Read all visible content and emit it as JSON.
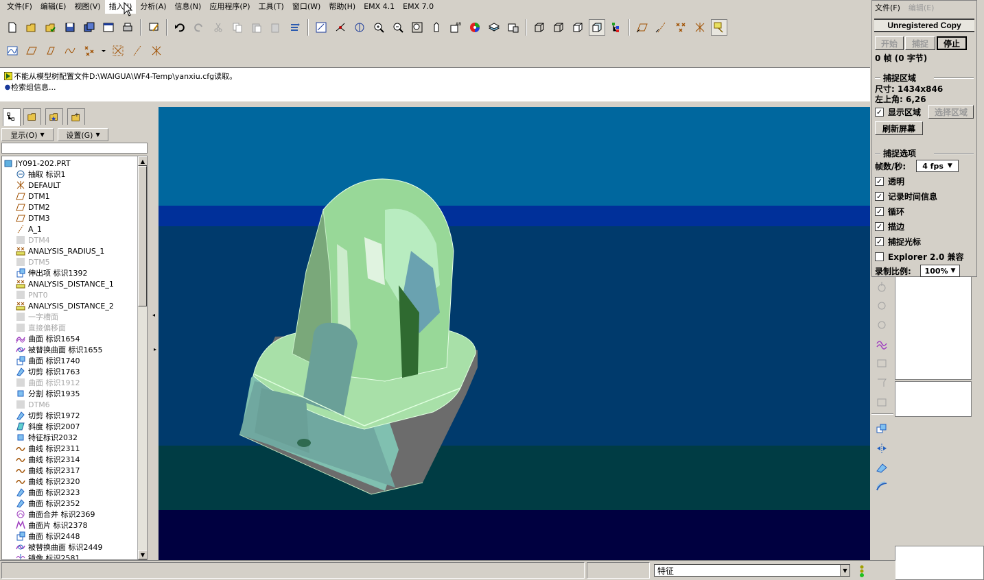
{
  "menu": [
    "文件(F)",
    "编辑(E)",
    "视图(V)",
    "插入(I)",
    "分析(A)",
    "信息(N)",
    "应用程序(P)",
    "工具(T)",
    "窗口(W)",
    "帮助(H)",
    "EMX 4.1",
    "EMX 7.0"
  ],
  "messages": [
    "不能从模型树配置文件D:\\WAIGUA\\WF4-Temp\\yanxiu.cfg读取。",
    "检索组信息..."
  ],
  "panel": {
    "show_label": "显示(O)",
    "settings_label": "设置(G)"
  },
  "tree": [
    {
      "label": "JY091-202.PRT",
      "icon": "part-icon",
      "dim": false
    },
    {
      "label": "抽取 标识1",
      "icon": "extract-icon",
      "dim": false
    },
    {
      "label": "DEFAULT",
      "icon": "csys-icon",
      "dim": false
    },
    {
      "label": "DTM1",
      "icon": "datum-plane-icon",
      "dim": false
    },
    {
      "label": "DTM2",
      "icon": "datum-plane-icon",
      "dim": false
    },
    {
      "label": "DTM3",
      "icon": "datum-plane-icon",
      "dim": false
    },
    {
      "label": "A_1",
      "icon": "datum-axis-icon",
      "dim": false
    },
    {
      "label": "DTM4",
      "icon": "suppressed-icon",
      "dim": true
    },
    {
      "label": "ANALYSIS_RADIUS_1",
      "icon": "analysis-icon",
      "dim": false
    },
    {
      "label": "DTM5",
      "icon": "suppressed-icon",
      "dim": true
    },
    {
      "label": "伸出项 标识1392",
      "icon": "protrusion-icon",
      "dim": false
    },
    {
      "label": "ANALYSIS_DISTANCE_1",
      "icon": "analysis-icon",
      "dim": false
    },
    {
      "label": "PNT0",
      "icon": "suppressed-icon",
      "dim": true
    },
    {
      "label": "ANALYSIS_DISTANCE_2",
      "icon": "analysis-icon",
      "dim": false
    },
    {
      "label": "一字槽面",
      "icon": "suppressed-icon",
      "dim": true
    },
    {
      "label": "直接偏移面",
      "icon": "suppressed-icon",
      "dim": true
    },
    {
      "label": "曲面 标识1654",
      "icon": "surface-icon",
      "dim": false
    },
    {
      "label": "被替换曲面 标识1655",
      "icon": "replace-surface-icon",
      "dim": false
    },
    {
      "label": "曲面 标识1740",
      "icon": "protrusion-icon",
      "dim": false
    },
    {
      "label": "切剪 标识1763",
      "icon": "cut-icon",
      "dim": false
    },
    {
      "label": "曲面 标识1912",
      "icon": "suppressed-icon",
      "dim": true
    },
    {
      "label": "分割 标识1935",
      "icon": "split-icon",
      "dim": false
    },
    {
      "label": "DTM6",
      "icon": "suppressed-icon",
      "dim": true
    },
    {
      "label": "切剪 标识1972",
      "icon": "cut-icon",
      "dim": false
    },
    {
      "label": "斜度 标识2007",
      "icon": "draft-icon",
      "dim": false
    },
    {
      "label": "特征标识2032",
      "icon": "split-icon",
      "dim": false
    },
    {
      "label": "曲线 标识2311",
      "icon": "curve-icon",
      "dim": false
    },
    {
      "label": "曲线 标识2314",
      "icon": "curve-icon",
      "dim": false
    },
    {
      "label": "曲线 标识2317",
      "icon": "curve-icon",
      "dim": false
    },
    {
      "label": "曲线 标识2320",
      "icon": "curve-icon",
      "dim": false
    },
    {
      "label": "曲面 标识2323",
      "icon": "cut-icon",
      "dim": false
    },
    {
      "label": "曲面 标识2352",
      "icon": "cut-icon",
      "dim": false
    },
    {
      "label": "曲面合并 标识2369",
      "icon": "merge-icon",
      "dim": false
    },
    {
      "label": "曲面片 标识2378",
      "icon": "patch-icon",
      "dim": false
    },
    {
      "label": "曲面 标识2448",
      "icon": "protrusion-icon",
      "dim": false
    },
    {
      "label": "被替换曲面 标识2449",
      "icon": "replace-surface-icon",
      "dim": false
    },
    {
      "label": "镜像 标识2581",
      "icon": "mirror-icon",
      "dim": false
    }
  ],
  "status": {
    "filter_value": "特征"
  },
  "capture": {
    "menu": [
      "文件(F)",
      "编辑(E)"
    ],
    "title": "Unregistered Copy",
    "btn_start": "开始",
    "btn_capture": "捕捉",
    "btn_stop": "停止",
    "frames": "0 帧 (0 字节)",
    "region_title": "捕捉区域",
    "size": "尺寸: 1434x846",
    "topleft": "左上角: 6,26",
    "show_region": "显示区域",
    "select_region": "选择区域",
    "refresh": "刷新屏幕",
    "options_title": "捕捉选项",
    "fps_label": "帧数/秒:",
    "fps_value": "4 fps",
    "opt_transparent": "透明",
    "opt_timestamps": "记录时间信息",
    "opt_loop": "循环",
    "opt_edges": "描边",
    "opt_cursor": "捕捉光标",
    "opt_explorer": "Explorer 2.0 兼容",
    "scale_label": "录制比例:",
    "scale_value": "100%"
  },
  "colors": {
    "viewport_band_top": "#006aa0",
    "viewport_band_2": "#023a98",
    "viewport_band_3": "#003c6c",
    "viewport_band_4": "#003e46",
    "viewport_band_bottom": "#000040",
    "model_green": "#a8e0a8",
    "model_dark": "#6a6a6a"
  }
}
